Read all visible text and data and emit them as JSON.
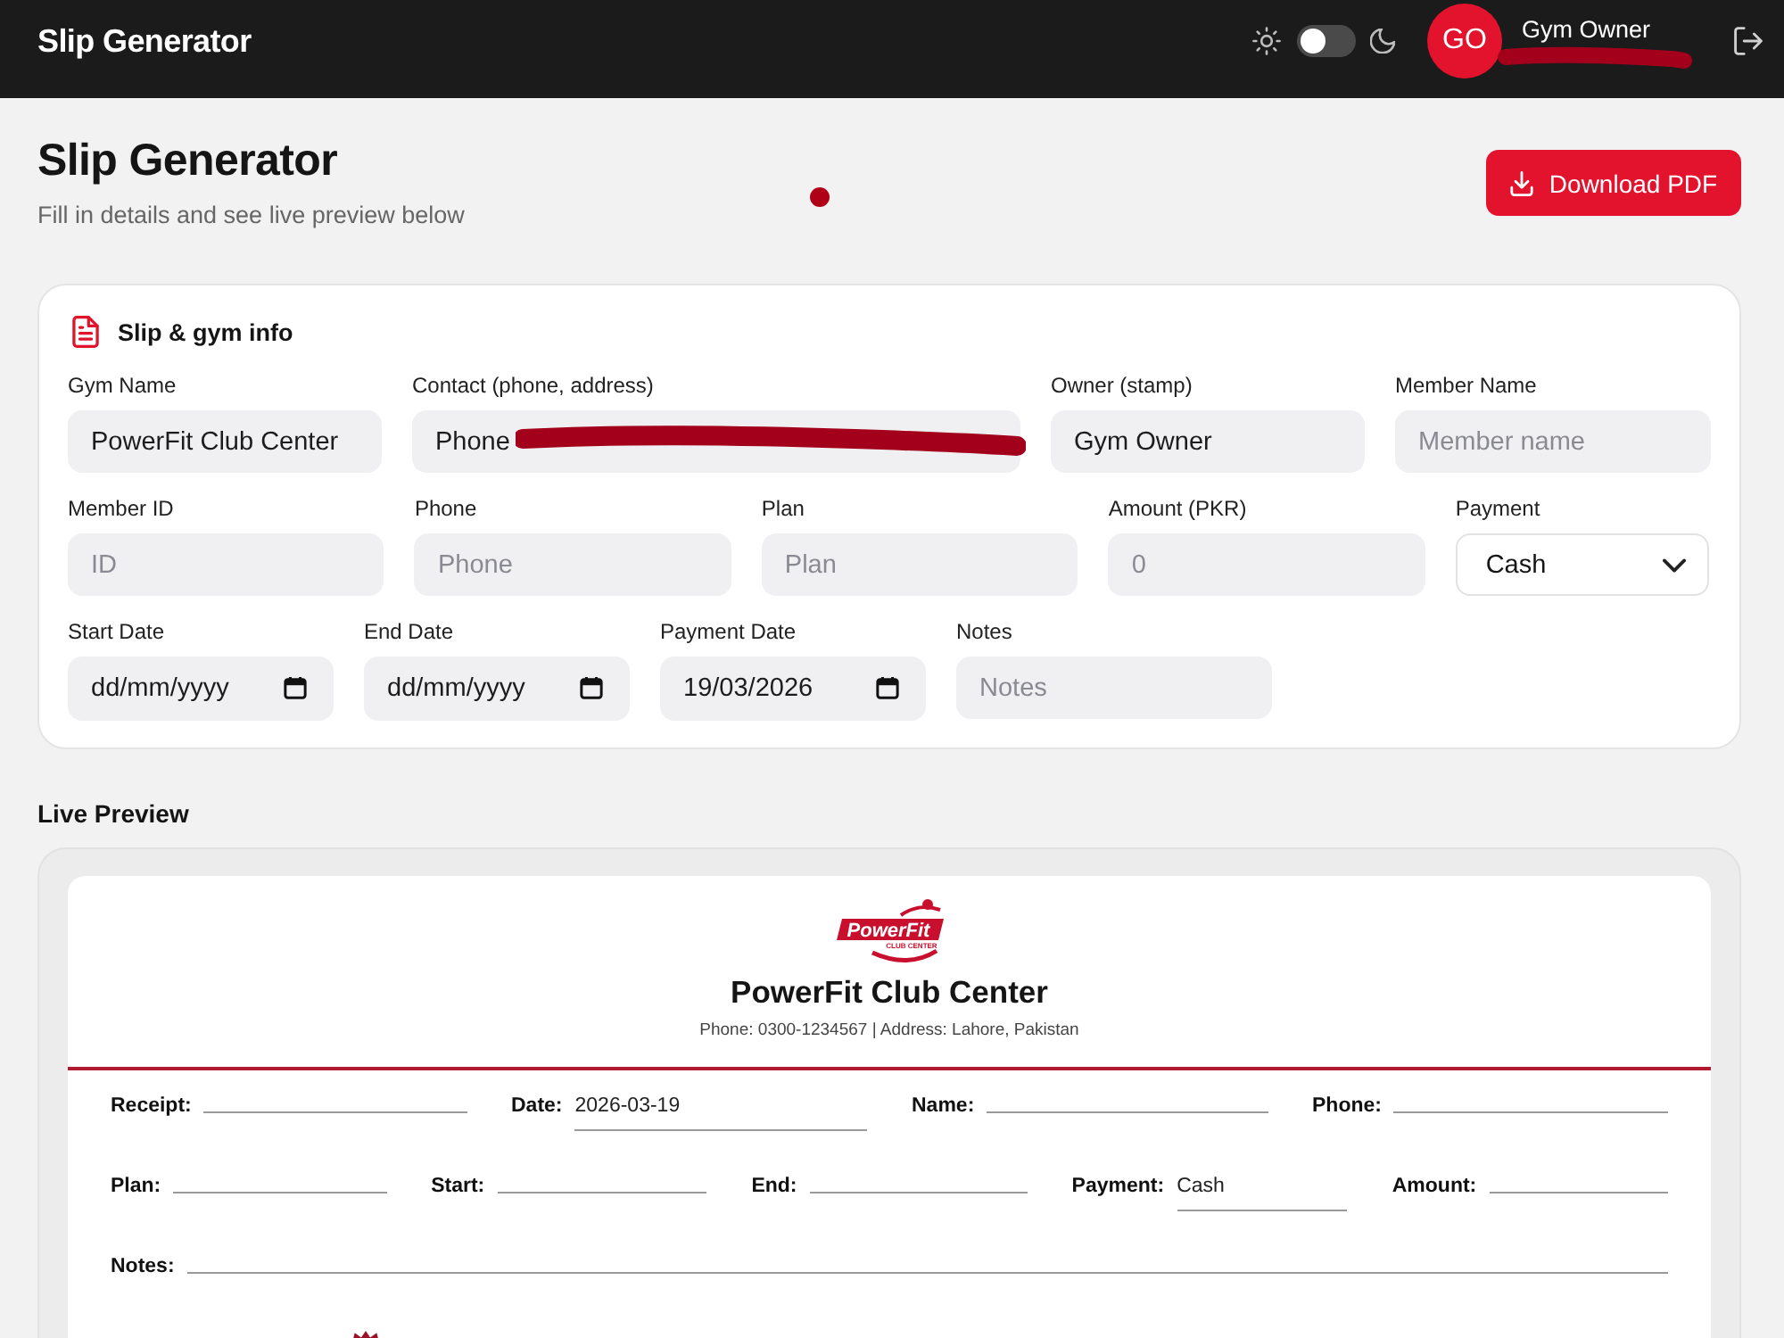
{
  "app_bar": {
    "title": "Slip Generator",
    "theme_toggle": {
      "on": false
    },
    "user": {
      "initials": "GO",
      "name": "Gym Owner",
      "redacted": true
    }
  },
  "page": {
    "title": "Slip Generator",
    "subtitle": "Fill in details and see live preview below",
    "download_button": "Download PDF"
  },
  "form": {
    "title": "Slip & gym info",
    "rows": [
      {
        "fields": [
          {
            "label": "Gym Name",
            "kind": "text",
            "value": "PowerFit Club Center"
          },
          {
            "label": "Contact (phone, address)",
            "kind": "redacted",
            "value": "Phone"
          },
          {
            "label": "Owner (stamp)",
            "kind": "text",
            "value": "Gym Owner"
          },
          {
            "label": "Member Name",
            "kind": "text",
            "placeholder": "Member name"
          }
        ]
      },
      {
        "fields": [
          {
            "label": "Member ID",
            "kind": "text",
            "placeholder": "ID"
          },
          {
            "label": "Phone",
            "kind": "text",
            "placeholder": "Phone"
          },
          {
            "label": "Plan",
            "kind": "text",
            "placeholder": "Plan"
          },
          {
            "label": "Amount (PKR)",
            "kind": "text",
            "placeholder": "0"
          },
          {
            "label": "Payment",
            "kind": "select",
            "value": "Cash"
          }
        ]
      },
      {
        "fields": [
          {
            "label": "Start Date",
            "kind": "date",
            "placeholder": "dd/mm/yyyy"
          },
          {
            "label": "End Date",
            "kind": "date",
            "placeholder": "dd/mm/yyyy"
          },
          {
            "label": "Payment Date",
            "kind": "date",
            "value": "19/03/2026"
          },
          {
            "label": "Notes",
            "kind": "text",
            "placeholder": "Notes"
          }
        ]
      }
    ]
  },
  "preview": {
    "title": "Live Preview",
    "logo": {
      "wordmark": "PowerFit",
      "tagline": "CLUB CENTER"
    },
    "gym_name": "PowerFit Club Center",
    "contact": "Phone: 0300-1234567 | Address: Lahore, Pakistan",
    "rows": [
      {
        "fields": [
          {
            "label": "Receipt:"
          },
          {
            "label": "Date:",
            "value": "2026-03-19"
          },
          {
            "label": "Name:"
          },
          {
            "label": "Phone:"
          }
        ]
      },
      {
        "fields": [
          {
            "label": "Plan:"
          },
          {
            "label": "Start:"
          },
          {
            "label": "End:"
          },
          {
            "label": "Payment:",
            "value": "Cash"
          },
          {
            "label": "Amount:"
          }
        ]
      },
      {
        "fields": [
          {
            "label": "Notes:"
          }
        ]
      }
    ]
  }
}
